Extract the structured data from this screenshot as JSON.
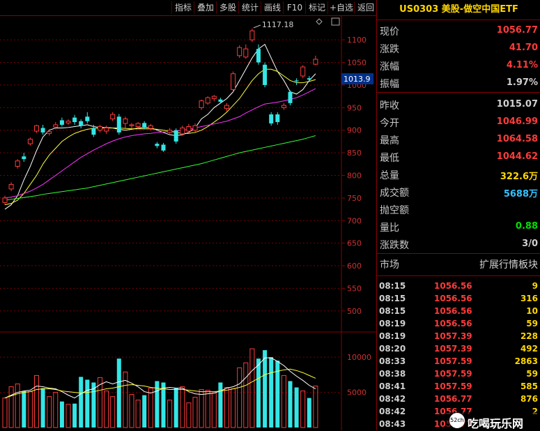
{
  "toolbar": {
    "items": [
      "指标",
      "叠加",
      "多股",
      "统计",
      "画线",
      "F10",
      "标记",
      "+自选",
      "返回"
    ]
  },
  "panel": {
    "title": "US0303 美股-做空中国ETF",
    "rows": [
      {
        "label": "现价",
        "value": "1056.77",
        "color": "#ff3b3b"
      },
      {
        "label": "涨跌",
        "value": "41.70",
        "color": "#ff3b3b"
      },
      {
        "label": "涨幅",
        "value": "4.11%",
        "color": "#ff3b3b"
      },
      {
        "label": "振幅",
        "value": "1.97%",
        "color": "#d0d0d0"
      },
      {
        "label": "昨收",
        "value": "1015.07",
        "color": "#d0d0d0"
      },
      {
        "label": "今开",
        "value": "1046.99",
        "color": "#ff3b3b"
      },
      {
        "label": "最高",
        "value": "1064.58",
        "color": "#ff3b3b"
      },
      {
        "label": "最低",
        "value": "1044.62",
        "color": "#ff3b3b"
      },
      {
        "label": "总量",
        "value": "322.6万",
        "color": "#ffd700"
      },
      {
        "label": "成交额",
        "value": "5688万",
        "color": "#33c3ff"
      },
      {
        "label": "抛空额",
        "value": "",
        "color": "#d0d0d0"
      },
      {
        "label": "量比",
        "value": "0.88",
        "color": "#00e000"
      },
      {
        "label": "涨跌数",
        "value": "3/0",
        "color": "#d0d0d0"
      }
    ],
    "market_label": "市场",
    "market_value": "扩展行情板块",
    "ticks": [
      {
        "time": "08:15",
        "price": "1056.56",
        "vol": "9"
      },
      {
        "time": "08:15",
        "price": "1056.56",
        "vol": "316"
      },
      {
        "time": "08:15",
        "price": "1056.56",
        "vol": "10"
      },
      {
        "time": "08:19",
        "price": "1056.56",
        "vol": "59"
      },
      {
        "time": "08:19",
        "price": "1057.39",
        "vol": "228"
      },
      {
        "time": "08:20",
        "price": "1057.39",
        "vol": "492"
      },
      {
        "time": "08:33",
        "price": "1057.59",
        "vol": "2863"
      },
      {
        "time": "08:38",
        "price": "1057.59",
        "vol": "59"
      },
      {
        "time": "08:41",
        "price": "1057.59",
        "vol": "585"
      },
      {
        "time": "08:42",
        "price": "1056.77",
        "vol": "876"
      },
      {
        "time": "08:42",
        "price": "1056.77",
        "vol": "2"
      },
      {
        "time": "08:43",
        "price": "1056.77",
        "vol": ""
      }
    ]
  },
  "chart_data": {
    "type": "candlestick",
    "price_axis": {
      "ticks": [
        500,
        550,
        600,
        650,
        700,
        750,
        800,
        850,
        900,
        950,
        1000,
        1050,
        1100
      ],
      "range": [
        475,
        1145
      ]
    },
    "current_price_label": "1013.9",
    "high_annotation": "1117.18",
    "volume_axis": {
      "ticks": [
        5000,
        10000
      ],
      "range": [
        0,
        12000
      ]
    },
    "candles": [
      {
        "o": 740,
        "c": 750,
        "h": 755,
        "l": 735,
        "v": 4200
      },
      {
        "o": 770,
        "c": 780,
        "h": 785,
        "l": 765,
        "v": 5800
      },
      {
        "o": 820,
        "c": 832,
        "h": 836,
        "l": 815,
        "v": 6200
      },
      {
        "o": 842,
        "c": 836,
        "h": 850,
        "l": 830,
        "v": 5200
      },
      {
        "o": 870,
        "c": 880,
        "h": 884,
        "l": 866,
        "v": 5100
      },
      {
        "o": 898,
        "c": 910,
        "h": 912,
        "l": 894,
        "v": 7400
      },
      {
        "o": 905,
        "c": 895,
        "h": 912,
        "l": 890,
        "v": 5600
      },
      {
        "o": 893,
        "c": 897,
        "h": 902,
        "l": 888,
        "v": 4400
      },
      {
        "o": 907,
        "c": 912,
        "h": 918,
        "l": 902,
        "v": 5000
      },
      {
        "o": 922,
        "c": 912,
        "h": 928,
        "l": 908,
        "v": 3700
      },
      {
        "o": 916,
        "c": 920,
        "h": 924,
        "l": 912,
        "v": 3300
      },
      {
        "o": 928,
        "c": 918,
        "h": 934,
        "l": 912,
        "v": 3400
      },
      {
        "o": 920,
        "c": 910,
        "h": 924,
        "l": 904,
        "v": 7200
      },
      {
        "o": 930,
        "c": 920,
        "h": 940,
        "l": 915,
        "v": 6800
      },
      {
        "o": 905,
        "c": 890,
        "h": 912,
        "l": 885,
        "v": 6400
      },
      {
        "o": 900,
        "c": 908,
        "h": 912,
        "l": 895,
        "v": 7100
      },
      {
        "o": 898,
        "c": 905,
        "h": 910,
        "l": 892,
        "v": 5200
      },
      {
        "o": 925,
        "c": 935,
        "h": 940,
        "l": 920,
        "v": 4400
      },
      {
        "o": 930,
        "c": 895,
        "h": 936,
        "l": 890,
        "v": 9800
      },
      {
        "o": 915,
        "c": 925,
        "h": 930,
        "l": 905,
        "v": 7900
      },
      {
        "o": 910,
        "c": 912,
        "h": 916,
        "l": 904,
        "v": 4700
      },
      {
        "o": 908,
        "c": 915,
        "h": 918,
        "l": 903,
        "v": 3900
      },
      {
        "o": 916,
        "c": 907,
        "h": 920,
        "l": 902,
        "v": 4600
      },
      {
        "o": 904,
        "c": 910,
        "h": 914,
        "l": 900,
        "v": 5600
      },
      {
        "o": 870,
        "c": 865,
        "h": 874,
        "l": 860,
        "v": 6600
      },
      {
        "o": 868,
        "c": 855,
        "h": 872,
        "l": 852,
        "v": 6400
      },
      {
        "o": 895,
        "c": 900,
        "h": 905,
        "l": 892,
        "v": 3900
      },
      {
        "o": 900,
        "c": 875,
        "h": 904,
        "l": 870,
        "v": 5600
      },
      {
        "o": 892,
        "c": 905,
        "h": 910,
        "l": 888,
        "v": 5800
      },
      {
        "o": 898,
        "c": 908,
        "h": 914,
        "l": 893,
        "v": 3500
      },
      {
        "o": 900,
        "c": 910,
        "h": 915,
        "l": 896,
        "v": 4300
      },
      {
        "o": 950,
        "c": 965,
        "h": 968,
        "l": 945,
        "v": 5400
      },
      {
        "o": 960,
        "c": 972,
        "h": 975,
        "l": 956,
        "v": 5300
      },
      {
        "o": 970,
        "c": 975,
        "h": 978,
        "l": 964,
        "v": 4900
      },
      {
        "o": 968,
        "c": 963,
        "h": 972,
        "l": 960,
        "v": 6400
      },
      {
        "o": 948,
        "c": 955,
        "h": 960,
        "l": 942,
        "v": 5700
      },
      {
        "o": 990,
        "c": 1025,
        "h": 1030,
        "l": 985,
        "v": 5500
      },
      {
        "o": 1065,
        "c": 1083,
        "h": 1088,
        "l": 1060,
        "v": 8500
      },
      {
        "o": 1062,
        "c": 1080,
        "h": 1090,
        "l": 1058,
        "v": 9200
      },
      {
        "o": 1100,
        "c": 1120,
        "h": 1125,
        "l": 1095,
        "v": 11200
      },
      {
        "o": 1080,
        "c": 1050,
        "h": 1090,
        "l": 1045,
        "v": 9800
      },
      {
        "o": 1045,
        "c": 1000,
        "h": 1050,
        "l": 995,
        "v": 11000
      },
      {
        "o": 935,
        "c": 915,
        "h": 940,
        "l": 910,
        "v": 10000
      },
      {
        "o": 935,
        "c": 918,
        "h": 940,
        "l": 912,
        "v": 9500
      },
      {
        "o": 950,
        "c": 955,
        "h": 960,
        "l": 945,
        "v": 7400
      },
      {
        "o": 985,
        "c": 960,
        "h": 988,
        "l": 955,
        "v": 6600
      },
      {
        "o": 1010,
        "c": 1008,
        "h": 1015,
        "l": 1000,
        "v": 5700
      },
      {
        "o": 1020,
        "c": 1040,
        "h": 1044,
        "l": 1015,
        "v": 5200
      },
      {
        "o": 1015,
        "c": 1012,
        "h": 1020,
        "l": 1008,
        "v": 4200
      },
      {
        "o": 1046,
        "c": 1057,
        "h": 1065,
        "l": 1044,
        "v": 5900
      }
    ],
    "ma_lines": [
      {
        "name": "MA5",
        "color": "#ffffff",
        "values": [
          725,
          735,
          755,
          790,
          820,
          855,
          885,
          900,
          905,
          905,
          906,
          908,
          910,
          912,
          908,
          906,
          906,
          905,
          902,
          900,
          902,
          905,
          906,
          906,
          900,
          895,
          890,
          888,
          890,
          895,
          905,
          925,
          935,
          950,
          960,
          970,
          985,
          1010,
          1035,
          1060,
          1080,
          1090,
          1060,
          1030,
          1010,
          985,
          980,
          990,
          1010,
          1025
        ]
      },
      {
        "name": "MA10",
        "color": "#ffff33",
        "values": [
          735,
          738,
          745,
          760,
          780,
          800,
          825,
          845,
          860,
          875,
          885,
          893,
          898,
          902,
          904,
          905,
          905,
          905,
          905,
          904,
          903,
          903,
          903,
          903,
          902,
          900,
          898,
          895,
          893,
          893,
          895,
          900,
          908,
          918,
          928,
          940,
          955,
          970,
          990,
          1010,
          1025,
          1035,
          1035,
          1030,
          1020,
          1010,
          1005,
          1005,
          1008,
          1012
        ]
      },
      {
        "name": "MA30",
        "color": "#ff33ff",
        "values": [
          750,
          752,
          755,
          760,
          765,
          772,
          780,
          790,
          800,
          810,
          820,
          830,
          840,
          848,
          856,
          863,
          870,
          876,
          881,
          885,
          888,
          890,
          892,
          893,
          895,
          896,
          897,
          898,
          900,
          902,
          905,
          908,
          911,
          914,
          917,
          920,
          925,
          930,
          938,
          945,
          952,
          958,
          960,
          962,
          965,
          968,
          972,
          978,
          985,
          992
        ]
      },
      {
        "name": "MA60",
        "color": "#33ff33",
        "values": [
          745,
          747,
          749,
          751,
          753,
          755,
          758,
          760,
          762,
          764,
          766,
          768,
          770,
          772,
          775,
          778,
          781,
          784,
          787,
          790,
          793,
          796,
          799,
          802,
          805,
          808,
          811,
          814,
          817,
          820,
          823,
          826,
          830,
          834,
          838,
          842,
          846,
          850,
          853,
          856,
          859,
          862,
          865,
          868,
          871,
          874,
          877,
          880,
          884,
          888
        ]
      }
    ],
    "vol_ma_lines": [
      {
        "name": "VMA5",
        "color": "#ffffff",
        "values": [
          4200,
          4600,
          5000,
          5200,
          5300,
          5900,
          5800,
          5600,
          5500,
          5100,
          4600,
          4200,
          4800,
          5300,
          5500,
          6100,
          6500,
          6200,
          6500,
          6700,
          6300,
          5800,
          5100,
          4900,
          5200,
          5600,
          5700,
          5600,
          5600,
          5100,
          4800,
          4700,
          4800,
          4900,
          5200,
          5600,
          5800,
          6200,
          7100,
          8100,
          8900,
          9900,
          9900,
          9400,
          8800,
          8000,
          7300,
          6700,
          6000,
          5500
        ]
      },
      {
        "name": "VMA10",
        "color": "#ffff33",
        "values": [
          4200,
          4500,
          4800,
          5000,
          5100,
          5400,
          5500,
          5500,
          5400,
          5200,
          5100,
          5000,
          4900,
          5000,
          5100,
          5300,
          5500,
          5600,
          5800,
          6000,
          6100,
          6000,
          5900,
          5700,
          5600,
          5500,
          5400,
          5400,
          5400,
          5300,
          5200,
          5100,
          5100,
          5100,
          5200,
          5300,
          5500,
          5700,
          6000,
          6500,
          7000,
          7500,
          7800,
          8000,
          8200,
          8300,
          8100,
          7800,
          7400,
          7000
        ]
      }
    ]
  }
}
